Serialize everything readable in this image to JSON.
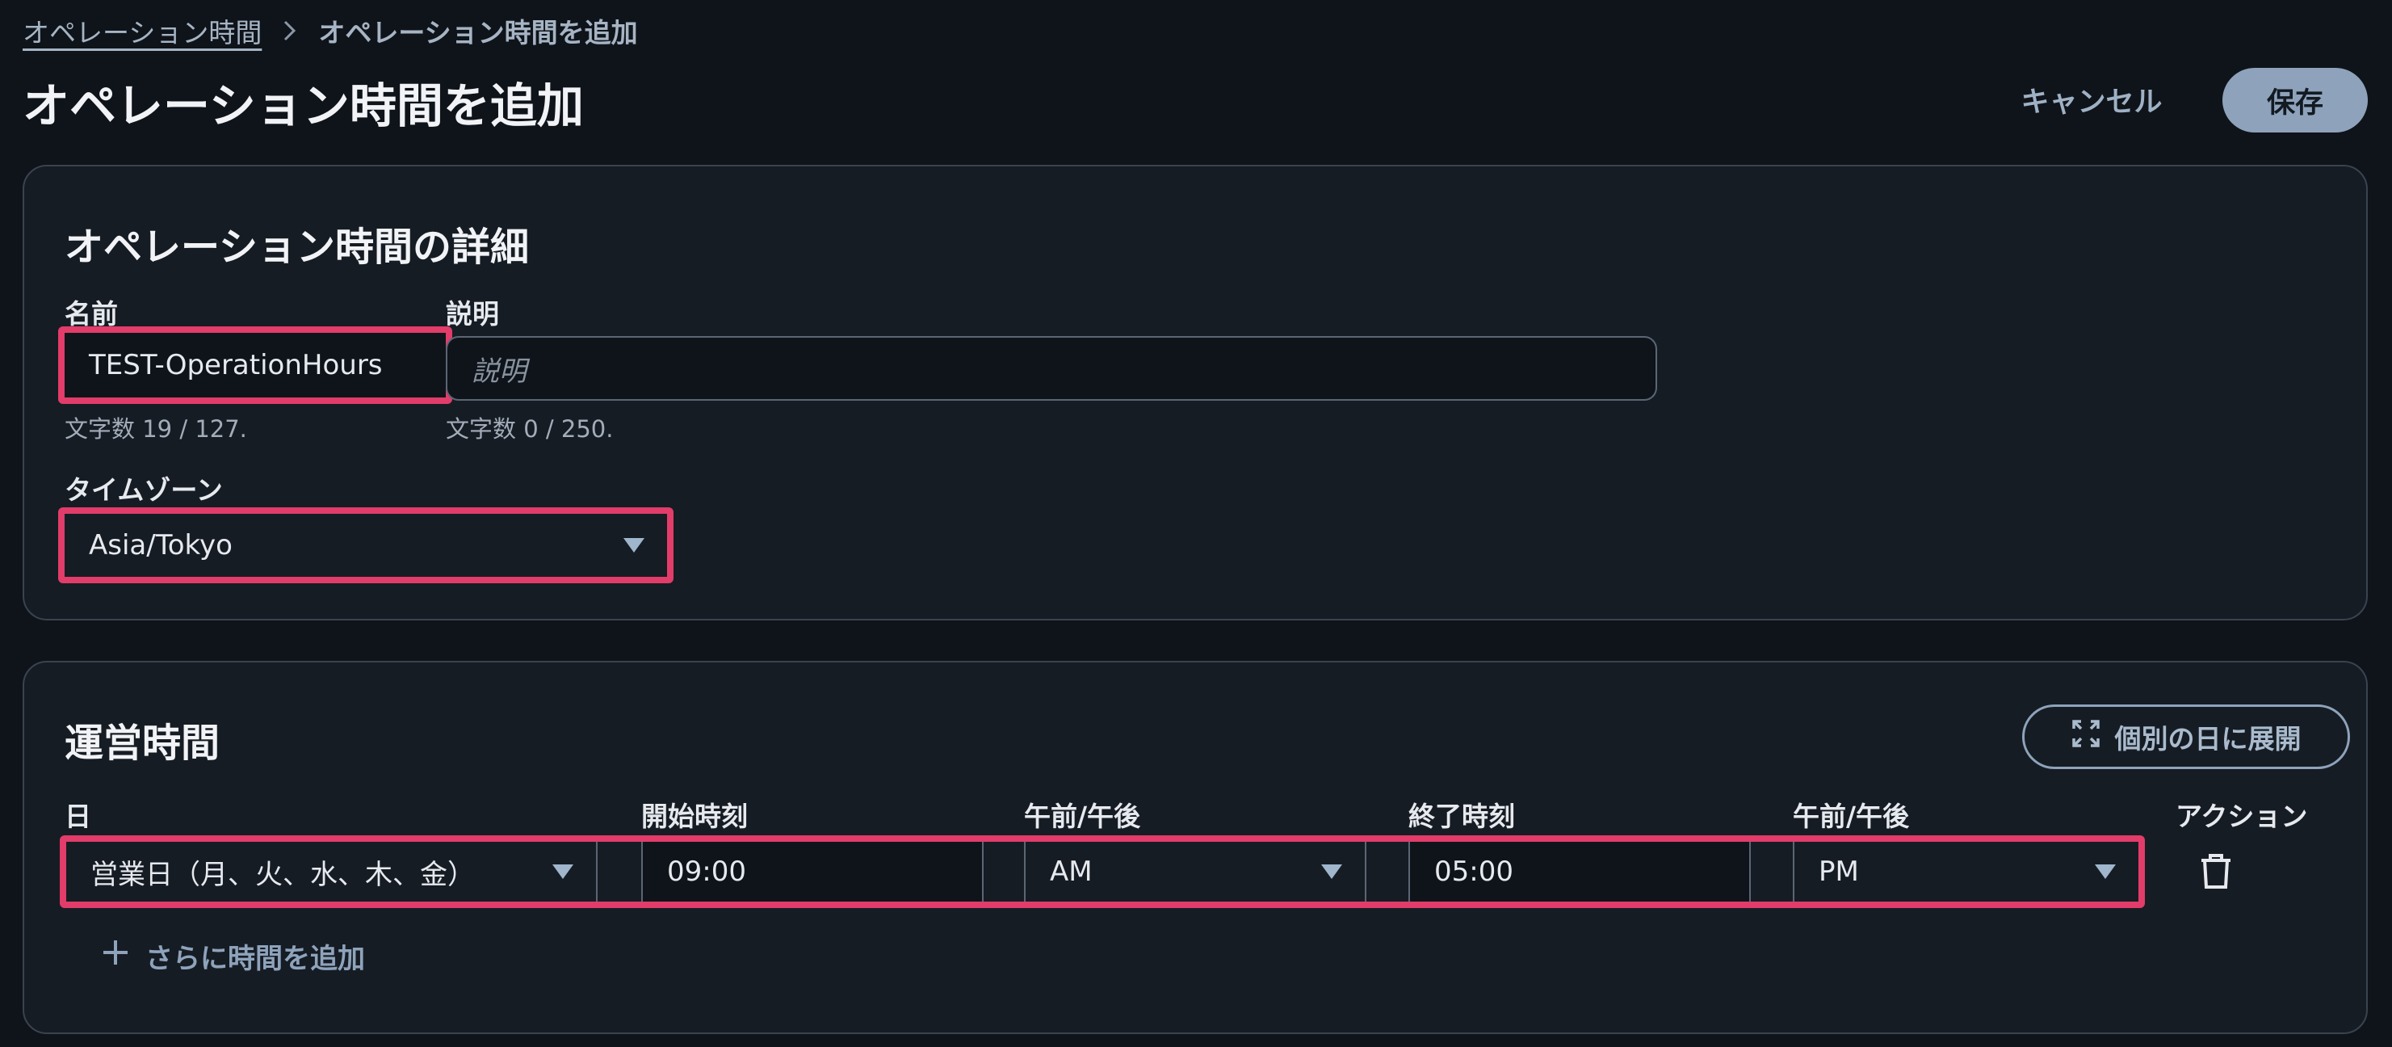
{
  "breadcrumb": {
    "parent": "オペレーション時間",
    "current": "オペレーション時間を追加"
  },
  "header": {
    "title": "オペレーション時間を追加",
    "cancel_label": "キャンセル",
    "save_label": "保存"
  },
  "details": {
    "title": "オペレーション時間の詳細",
    "name_label": "名前",
    "name_value": "TEST-OperationHours",
    "name_count": "文字数 19 / 127.",
    "description_label": "説明",
    "description_placeholder": "説明",
    "description_count": "文字数 0 / 250.",
    "timezone_label": "タイムゾーン",
    "timezone_value": "Asia/Tokyo"
  },
  "hours": {
    "title": "運営時間",
    "expand_label": "個別の日に展開",
    "columns": {
      "day": "日",
      "start": "開始時刻",
      "start_ampm": "午前/午後",
      "end": "終了時刻",
      "end_ampm": "午前/午後",
      "action": "アクション"
    },
    "row": {
      "day": "営業日（月、火、水、木、金）",
      "start_time": "09:00",
      "start_ampm": "AM",
      "end_time": "05:00",
      "end_ampm": "PM"
    },
    "add_more_label": "さらに時間を追加"
  },
  "colors": {
    "background": "#0f141a",
    "card": "#161c24",
    "accent": "#8ea3bb",
    "highlight": "#e23c6a"
  },
  "icons": [
    "chevron-right-icon",
    "caret-down-icon",
    "expand-icon",
    "trash-icon",
    "plus-icon"
  ]
}
